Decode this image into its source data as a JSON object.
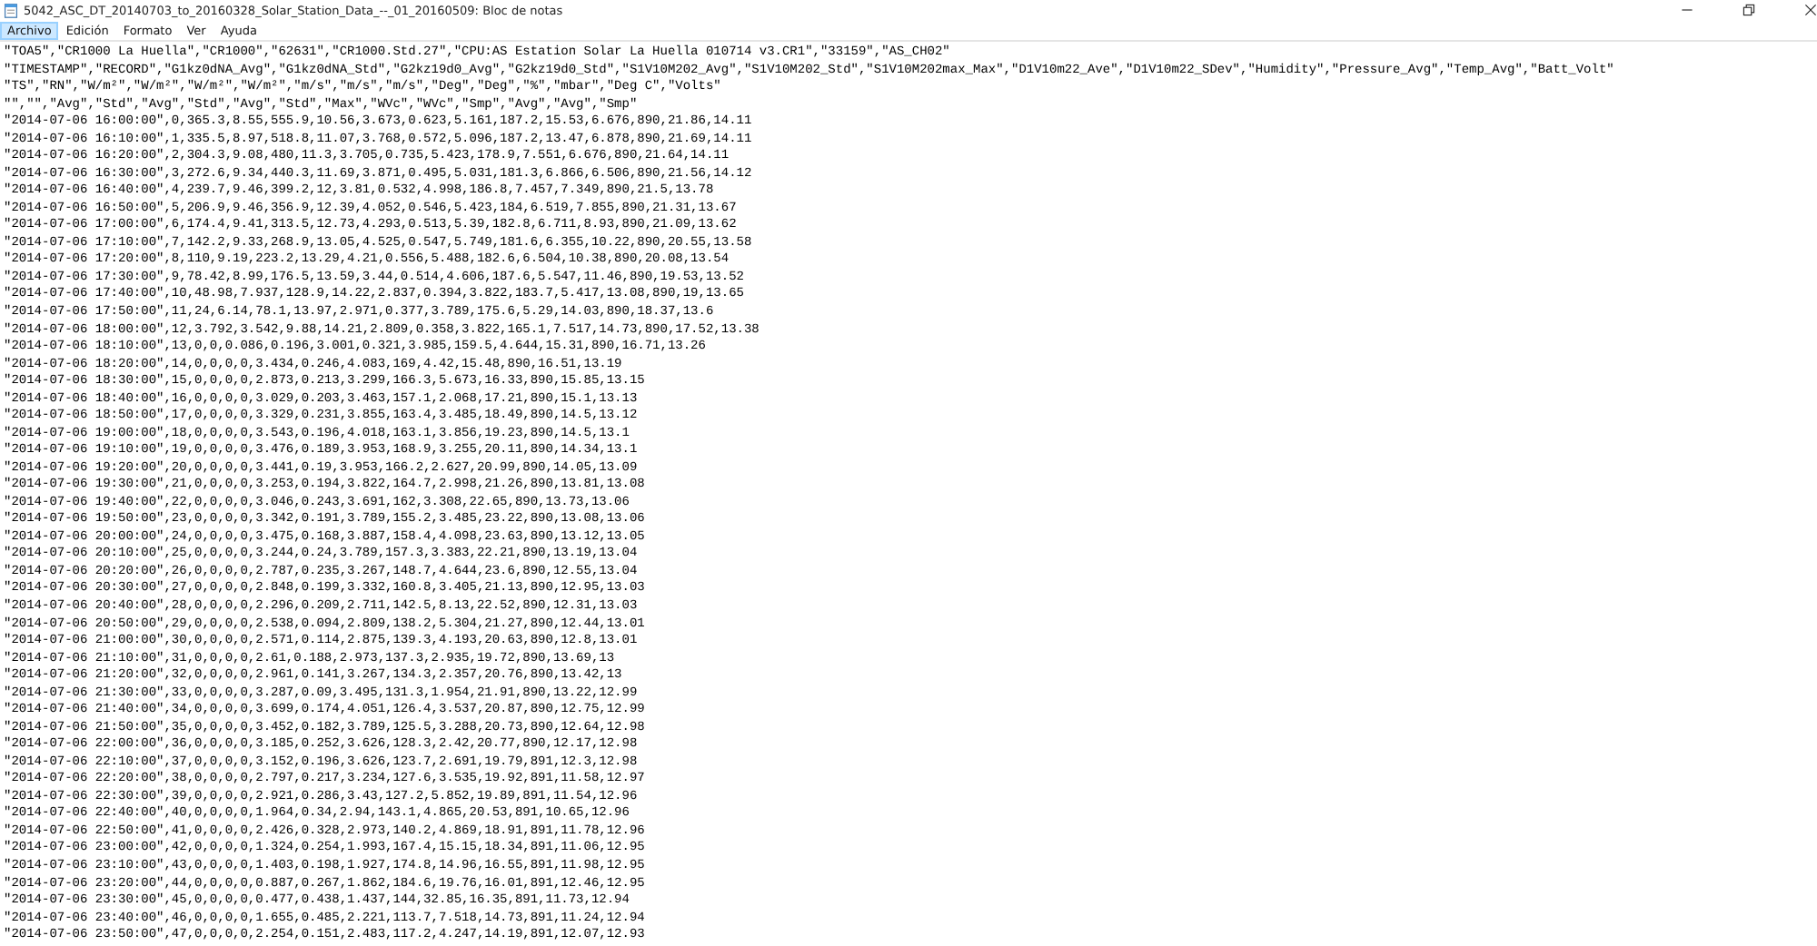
{
  "window": {
    "title": "5042_ASC_DT_20140703_to_20160328_Solar_Station_Data_--_01_20160509: Bloc de notas"
  },
  "menu": [
    {
      "label": "Archivo",
      "selected": true
    },
    {
      "label": "Edición",
      "selected": false
    },
    {
      "label": "Formato",
      "selected": false
    },
    {
      "label": "Ver",
      "selected": false
    },
    {
      "label": "Ayuda",
      "selected": false
    }
  ],
  "editor": {
    "lines": [
      "\"TOA5\",\"CR1000 La Huella\",\"CR1000\",\"62631\",\"CR1000.Std.27\",\"CPU:AS Estation Solar La Huella 010714 v3.CR1\",\"33159\",\"AS_CH02\"",
      "\"TIMESTAMP\",\"RECORD\",\"G1kz0dNA_Avg\",\"G1kz0dNA_Std\",\"G2kz19d0_Avg\",\"G2kz19d0_Std\",\"S1V10M202_Avg\",\"S1V10M202_Std\",\"S1V10M202max_Max\",\"D1V10m22_Ave\",\"D1V10m22_SDev\",\"Humidity\",\"Pressure_Avg\",\"Temp_Avg\",\"Batt_Volt\"",
      "\"TS\",\"RN\",\"W/m²\",\"W/m²\",\"W/m²\",\"W/m²\",\"m/s\",\"m/s\",\"m/s\",\"Deg\",\"Deg\",\"%\",\"mbar\",\"Deg C\",\"Volts\"",
      "\"\",\"\",\"Avg\",\"Std\",\"Avg\",\"Std\",\"Avg\",\"Std\",\"Max\",\"WVc\",\"WVc\",\"Smp\",\"Avg\",\"Avg\",\"Smp\"",
      "\"2014-07-06 16:00:00\",0,365.3,8.55,555.9,10.56,3.673,0.623,5.161,187.2,15.53,6.676,890,21.86,14.11",
      "\"2014-07-06 16:10:00\",1,335.5,8.97,518.8,11.07,3.768,0.572,5.096,187.2,13.47,6.878,890,21.69,14.11",
      "\"2014-07-06 16:20:00\",2,304.3,9.08,480,11.3,3.705,0.735,5.423,178.9,7.551,6.676,890,21.64,14.11",
      "\"2014-07-06 16:30:00\",3,272.6,9.34,440.3,11.69,3.871,0.495,5.031,181.3,6.866,6.506,890,21.56,14.12",
      "\"2014-07-06 16:40:00\",4,239.7,9.46,399.2,12,3.81,0.532,4.998,186.8,7.457,7.349,890,21.5,13.78",
      "\"2014-07-06 16:50:00\",5,206.9,9.46,356.9,12.39,4.052,0.546,5.423,184,6.519,7.855,890,21.31,13.67",
      "\"2014-07-06 17:00:00\",6,174.4,9.41,313.5,12.73,4.293,0.513,5.39,182.8,6.711,8.93,890,21.09,13.62",
      "\"2014-07-06 17:10:00\",7,142.2,9.33,268.9,13.05,4.525,0.547,5.749,181.6,6.355,10.22,890,20.55,13.58",
      "\"2014-07-06 17:20:00\",8,110,9.19,223.2,13.29,4.21,0.556,5.488,182.6,6.504,10.38,890,20.08,13.54",
      "\"2014-07-06 17:30:00\",9,78.42,8.99,176.5,13.59,3.44,0.514,4.606,187.6,5.547,11.46,890,19.53,13.52",
      "\"2014-07-06 17:40:00\",10,48.98,7.937,128.9,14.22,2.837,0.394,3.822,183.7,5.417,13.08,890,19,13.65",
      "\"2014-07-06 17:50:00\",11,24,6.14,78.1,13.97,2.971,0.377,3.789,175.6,5.29,14.03,890,18.37,13.6",
      "\"2014-07-06 18:00:00\",12,3.792,3.542,9.88,14.21,2.809,0.358,3.822,165.1,7.517,14.73,890,17.52,13.38",
      "\"2014-07-06 18:10:00\",13,0,0,0.086,0.196,3.001,0.321,3.985,159.5,4.644,15.31,890,16.71,13.26",
      "\"2014-07-06 18:20:00\",14,0,0,0,0,3.434,0.246,4.083,169,4.42,15.48,890,16.51,13.19",
      "\"2014-07-06 18:30:00\",15,0,0,0,0,2.873,0.213,3.299,166.3,5.673,16.33,890,15.85,13.15",
      "\"2014-07-06 18:40:00\",16,0,0,0,0,3.029,0.203,3.463,157.1,2.068,17.21,890,15.1,13.13",
      "\"2014-07-06 18:50:00\",17,0,0,0,0,3.329,0.231,3.855,163.4,3.485,18.49,890,14.5,13.12",
      "\"2014-07-06 19:00:00\",18,0,0,0,0,3.543,0.196,4.018,163.1,3.856,19.23,890,14.5,13.1",
      "\"2014-07-06 19:10:00\",19,0,0,0,0,3.476,0.189,3.953,168.9,3.255,20.11,890,14.34,13.1",
      "\"2014-07-06 19:20:00\",20,0,0,0,0,3.441,0.19,3.953,166.2,2.627,20.99,890,14.05,13.09",
      "\"2014-07-06 19:30:00\",21,0,0,0,0,3.253,0.194,3.822,164.7,2.998,21.26,890,13.81,13.08",
      "\"2014-07-06 19:40:00\",22,0,0,0,0,3.046,0.243,3.691,162,3.308,22.65,890,13.73,13.06",
      "\"2014-07-06 19:50:00\",23,0,0,0,0,3.342,0.191,3.789,155.2,3.485,23.22,890,13.08,13.06",
      "\"2014-07-06 20:00:00\",24,0,0,0,0,3.475,0.168,3.887,158.4,4.098,23.63,890,13.12,13.05",
      "\"2014-07-06 20:10:00\",25,0,0,0,0,3.244,0.24,3.789,157.3,3.383,22.21,890,13.19,13.04",
      "\"2014-07-06 20:20:00\",26,0,0,0,0,2.787,0.235,3.267,148.7,4.644,23.6,890,12.55,13.04",
      "\"2014-07-06 20:30:00\",27,0,0,0,0,2.848,0.199,3.332,160.8,3.405,21.13,890,12.95,13.03",
      "\"2014-07-06 20:40:00\",28,0,0,0,0,2.296,0.209,2.711,142.5,8.13,22.52,890,12.31,13.03",
      "\"2014-07-06 20:50:00\",29,0,0,0,0,2.538,0.094,2.809,138.2,5.304,21.27,890,12.44,13.01",
      "\"2014-07-06 21:00:00\",30,0,0,0,0,2.571,0.114,2.875,139.3,4.193,20.63,890,12.8,13.01",
      "\"2014-07-06 21:10:00\",31,0,0,0,0,2.61,0.188,2.973,137.3,2.935,19.72,890,13.69,13",
      "\"2014-07-06 21:20:00\",32,0,0,0,0,2.961,0.141,3.267,134.3,2.357,20.76,890,13.42,13",
      "\"2014-07-06 21:30:00\",33,0,0,0,0,3.287,0.09,3.495,131.3,1.954,21.91,890,13.22,12.99",
      "\"2014-07-06 21:40:00\",34,0,0,0,0,3.699,0.174,4.051,126.4,3.537,20.87,890,12.75,12.99",
      "\"2014-07-06 21:50:00\",35,0,0,0,0,3.452,0.182,3.789,125.5,3.288,20.73,890,12.64,12.98",
      "\"2014-07-06 22:00:00\",36,0,0,0,0,3.185,0.252,3.626,128.3,2.42,20.77,890,12.17,12.98",
      "\"2014-07-06 22:10:00\",37,0,0,0,0,3.152,0.196,3.626,123.7,2.691,19.79,891,12.3,12.98",
      "\"2014-07-06 22:20:00\",38,0,0,0,0,2.797,0.217,3.234,127.6,3.535,19.92,891,11.58,12.97",
      "\"2014-07-06 22:30:00\",39,0,0,0,0,2.921,0.286,3.43,127.2,5.852,19.89,891,11.54,12.96",
      "\"2014-07-06 22:40:00\",40,0,0,0,0,1.964,0.34,2.94,143.1,4.865,20.53,891,10.65,12.96",
      "\"2014-07-06 22:50:00\",41,0,0,0,0,2.426,0.328,2.973,140.2,4.869,18.91,891,11.78,12.96",
      "\"2014-07-06 23:00:00\",42,0,0,0,0,1.324,0.254,1.993,167.4,15.15,18.34,891,11.06,12.95",
      "\"2014-07-06 23:10:00\",43,0,0,0,0,1.403,0.198,1.927,174.8,14.96,16.55,891,11.98,12.95",
      "\"2014-07-06 23:20:00\",44,0,0,0,0,0.887,0.267,1.862,184.6,19.76,16.01,891,12.46,12.95",
      "\"2014-07-06 23:30:00\",45,0,0,0,0,0.477,0.438,1.437,144,32.85,16.35,891,11.73,12.94",
      "\"2014-07-06 23:40:00\",46,0,0,0,0,1.655,0.485,2.221,113.7,7.518,14.73,891,11.24,12.94",
      "\"2014-07-06 23:50:00\",47,0,0,0,0,2.254,0.151,2.483,117.2,4.247,14.19,891,12.07,12.93"
    ]
  }
}
